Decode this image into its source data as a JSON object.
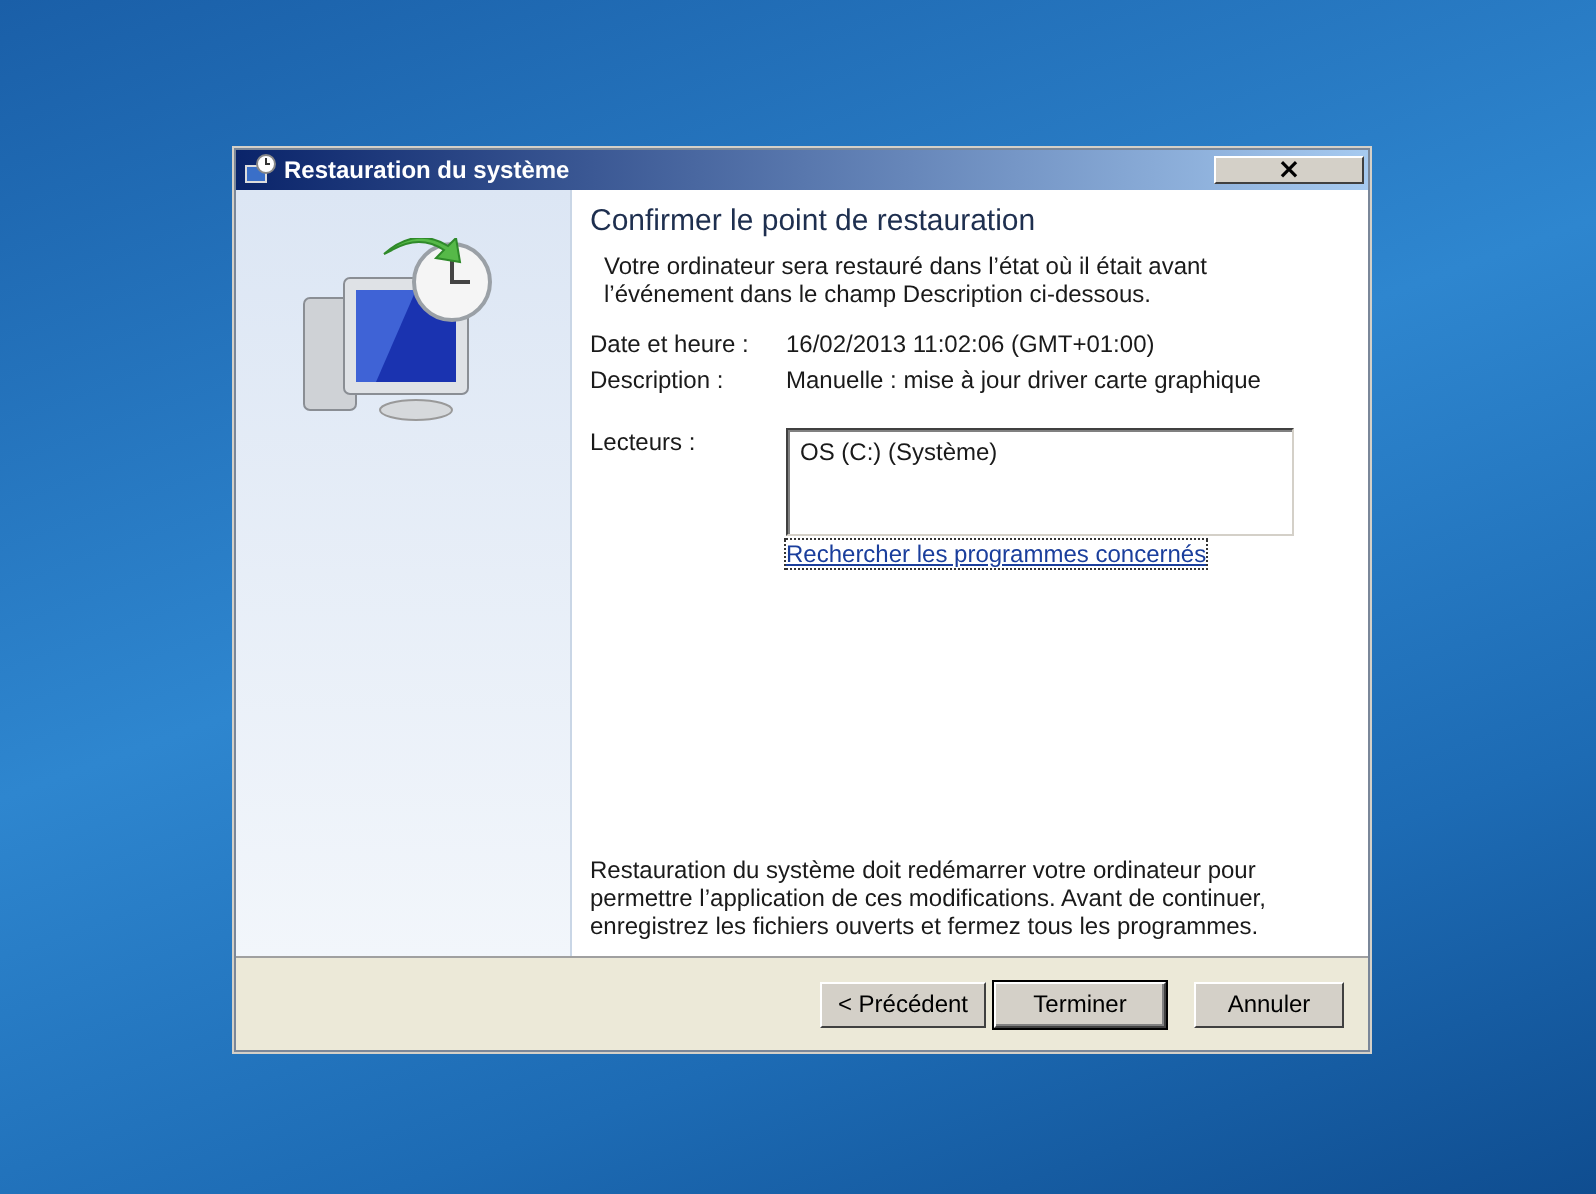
{
  "window": {
    "title": "Restauration du système",
    "close": "×"
  },
  "page": {
    "heading": "Confirmer le point de restauration",
    "intro": "Votre ordinateur sera restauré dans l’état où il était avant l’événement dans le champ Description ci-dessous.",
    "fields": [
      {
        "label": "Date et heure :",
        "value": "16/02/2013 11:02:06 (GMT+01:00)"
      },
      {
        "label": "Description :",
        "value": "Manuelle : mise à jour driver carte graphique"
      }
    ],
    "drives": {
      "label": "Lecteurs :",
      "items": [
        "OS (C:) (Système)"
      ]
    },
    "link": "Rechercher les programmes concernés",
    "notice": "Restauration du système doit redémarrer votre ordinateur pour permettre l’application de ces modifications. Avant de continuer, enregistrez les fichiers ouverts et fermez tous les programmes."
  },
  "buttons": [
    {
      "label": "< Précédent",
      "default": false
    },
    {
      "label": "Terminer",
      "default": true
    },
    {
      "label": "Annuler",
      "default": false
    }
  ]
}
